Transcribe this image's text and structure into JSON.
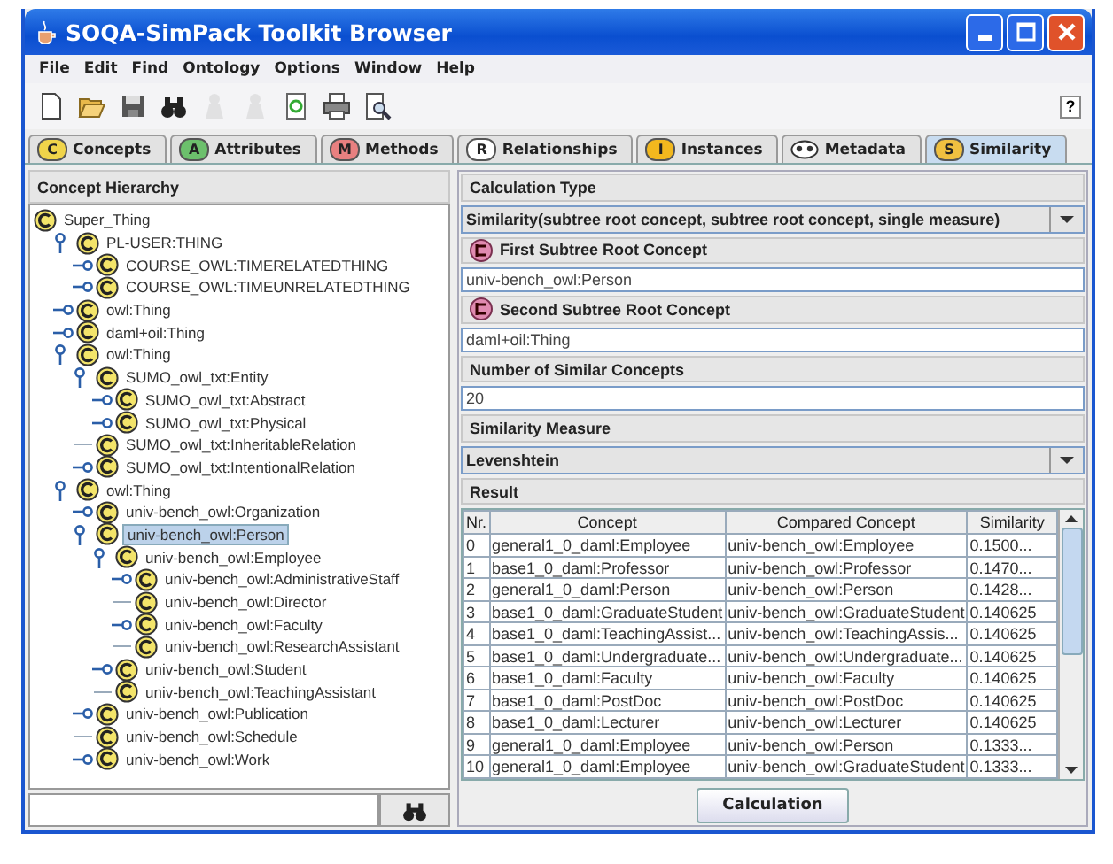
{
  "window": {
    "title": "SOQA-SimPack Toolkit Browser"
  },
  "menu": [
    "File",
    "Edit",
    "Find",
    "Ontology",
    "Options",
    "Window",
    "Help"
  ],
  "toolbar": [
    {
      "kind": "new",
      "disabled": false
    },
    {
      "kind": "open",
      "disabled": false
    },
    {
      "kind": "save",
      "disabled": false
    },
    {
      "kind": "find",
      "disabled": false
    },
    {
      "kind": "person",
      "disabled": true
    },
    {
      "kind": "person",
      "disabled": true
    },
    {
      "kind": "refresh",
      "disabled": false
    },
    {
      "kind": "print",
      "disabled": false
    },
    {
      "kind": "preview",
      "disabled": false
    }
  ],
  "help_button": "?",
  "tabs": [
    {
      "label": "Concepts",
      "letter": "C",
      "color": "#f0d44a",
      "selected": false
    },
    {
      "label": "Attributes",
      "letter": "A",
      "color": "#6cc06c",
      "selected": false
    },
    {
      "label": "Methods",
      "letter": "M",
      "color": "#e88080",
      "selected": false
    },
    {
      "label": "Relationships",
      "letter": "R",
      "color": "#ffffff",
      "selected": false
    },
    {
      "label": "Instances",
      "letter": "I",
      "color": "#f2b81e",
      "selected": false
    },
    {
      "label": "Metadata",
      "color": "#ffffff",
      "selected": false
    },
    {
      "label": "Similarity",
      "letter": "S",
      "color": "#f0c040",
      "selected": true
    }
  ],
  "concept_hierarchy": {
    "title": "Concept Hierarchy",
    "tree": [
      {
        "label": "Super_Thing",
        "kind": "root",
        "selected": false,
        "children": [
          {
            "label": "PL-USER:THING",
            "kind": "branch",
            "expanded": true,
            "selected": false,
            "children": [
              {
                "label": "COURSE_OWL:TIMERELATEDTHING",
                "kind": "branch",
                "expanded": false,
                "selected": false
              },
              {
                "label": "COURSE_OWL:TIMEUNRELATEDTHING",
                "kind": "branch",
                "expanded": false,
                "selected": false
              }
            ]
          },
          {
            "label": "owl:Thing",
            "kind": "branch",
            "expanded": false,
            "selected": false
          },
          {
            "label": "daml+oil:Thing",
            "kind": "branch",
            "expanded": false,
            "selected": false
          },
          {
            "label": "owl:Thing",
            "kind": "branch",
            "expanded": true,
            "selected": false,
            "children": [
              {
                "label": "SUMO_owl_txt:Entity",
                "kind": "branch",
                "expanded": true,
                "selected": false,
                "children": [
                  {
                    "label": "SUMO_owl_txt:Abstract",
                    "kind": "branch",
                    "expanded": false,
                    "selected": false
                  },
                  {
                    "label": "SUMO_owl_txt:Physical",
                    "kind": "branch",
                    "expanded": false,
                    "selected": false
                  }
                ]
              },
              {
                "label": "SUMO_owl_txt:InheritableRelation",
                "kind": "leaf",
                "selected": false
              },
              {
                "label": "SUMO_owl_txt:IntentionalRelation",
                "kind": "branch",
                "expanded": false,
                "selected": false
              }
            ]
          },
          {
            "label": "owl:Thing",
            "kind": "branch",
            "expanded": true,
            "selected": false,
            "children": [
              {
                "label": "univ-bench_owl:Organization",
                "kind": "branch",
                "expanded": false,
                "selected": false
              },
              {
                "label": "univ-bench_owl:Person",
                "kind": "branch",
                "expanded": true,
                "selected": true,
                "children": [
                  {
                    "label": "univ-bench_owl:Employee",
                    "kind": "branch",
                    "expanded": true,
                    "selected": false,
                    "children": [
                      {
                        "label": "univ-bench_owl:AdministrativeStaff",
                        "kind": "branch",
                        "expanded": false,
                        "selected": false
                      },
                      {
                        "label": "univ-bench_owl:Director",
                        "kind": "leaf",
                        "selected": false
                      },
                      {
                        "label": "univ-bench_owl:Faculty",
                        "kind": "branch",
                        "expanded": false,
                        "selected": false
                      },
                      {
                        "label": "univ-bench_owl:ResearchAssistant",
                        "kind": "leaf",
                        "selected": false
                      }
                    ]
                  },
                  {
                    "label": "univ-bench_owl:Student",
                    "kind": "branch",
                    "expanded": false,
                    "selected": false
                  },
                  {
                    "label": "univ-bench_owl:TeachingAssistant",
                    "kind": "leaf",
                    "selected": false
                  }
                ]
              },
              {
                "label": "univ-bench_owl:Publication",
                "kind": "branch",
                "expanded": false,
                "selected": false
              },
              {
                "label": "univ-bench_owl:Schedule",
                "kind": "leaf",
                "selected": false
              },
              {
                "label": "univ-bench_owl:Work",
                "kind": "branch",
                "expanded": false,
                "selected": false
              }
            ]
          }
        ]
      }
    ]
  },
  "similarity": {
    "calculation_type": {
      "label": "Calculation Type",
      "value": "Similarity(subtree root concept, subtree root concept, single measure)"
    },
    "first_concept": {
      "label": "First Subtree Root Concept",
      "value": "univ-bench_owl:Person"
    },
    "second_concept": {
      "label": "Second Subtree Root Concept",
      "value": "daml+oil:Thing"
    },
    "count": {
      "label": "Number of Similar Concepts",
      "value": "20"
    },
    "measure": {
      "label": "Similarity Measure",
      "value": "Levenshtein"
    },
    "result": {
      "label": "Result",
      "columns": [
        "Nr.",
        "Concept",
        "Compared Concept",
        "Similarity"
      ],
      "rows": [
        [
          "0",
          "general1_0_daml:Employee",
          "univ-bench_owl:Employee",
          "0.1500..."
        ],
        [
          "1",
          "base1_0_daml:Professor",
          "univ-bench_owl:Professor",
          "0.1470..."
        ],
        [
          "2",
          "general1_0_daml:Person",
          "univ-bench_owl:Person",
          "0.1428..."
        ],
        [
          "3",
          "base1_0_daml:GraduateStudent",
          "univ-bench_owl:GraduateStudent",
          "0.140625"
        ],
        [
          "4",
          "base1_0_daml:TeachingAssist...",
          "univ-bench_owl:TeachingAssis...",
          "0.140625"
        ],
        [
          "5",
          "base1_0_daml:Undergraduate...",
          "univ-bench_owl:Undergraduate...",
          "0.140625"
        ],
        [
          "6",
          "base1_0_daml:Faculty",
          "univ-bench_owl:Faculty",
          "0.140625"
        ],
        [
          "7",
          "base1_0_daml:PostDoc",
          "univ-bench_owl:PostDoc",
          "0.140625"
        ],
        [
          "8",
          "base1_0_daml:Lecturer",
          "univ-bench_owl:Lecturer",
          "0.140625"
        ],
        [
          "9",
          "general1_0_daml:Employee",
          "univ-bench_owl:Person",
          "0.1333..."
        ],
        [
          "10",
          "general1_0_daml:Employee",
          "univ-bench_owl:GraduateStudent",
          "0.1333..."
        ]
      ]
    },
    "button": "Calculation"
  }
}
